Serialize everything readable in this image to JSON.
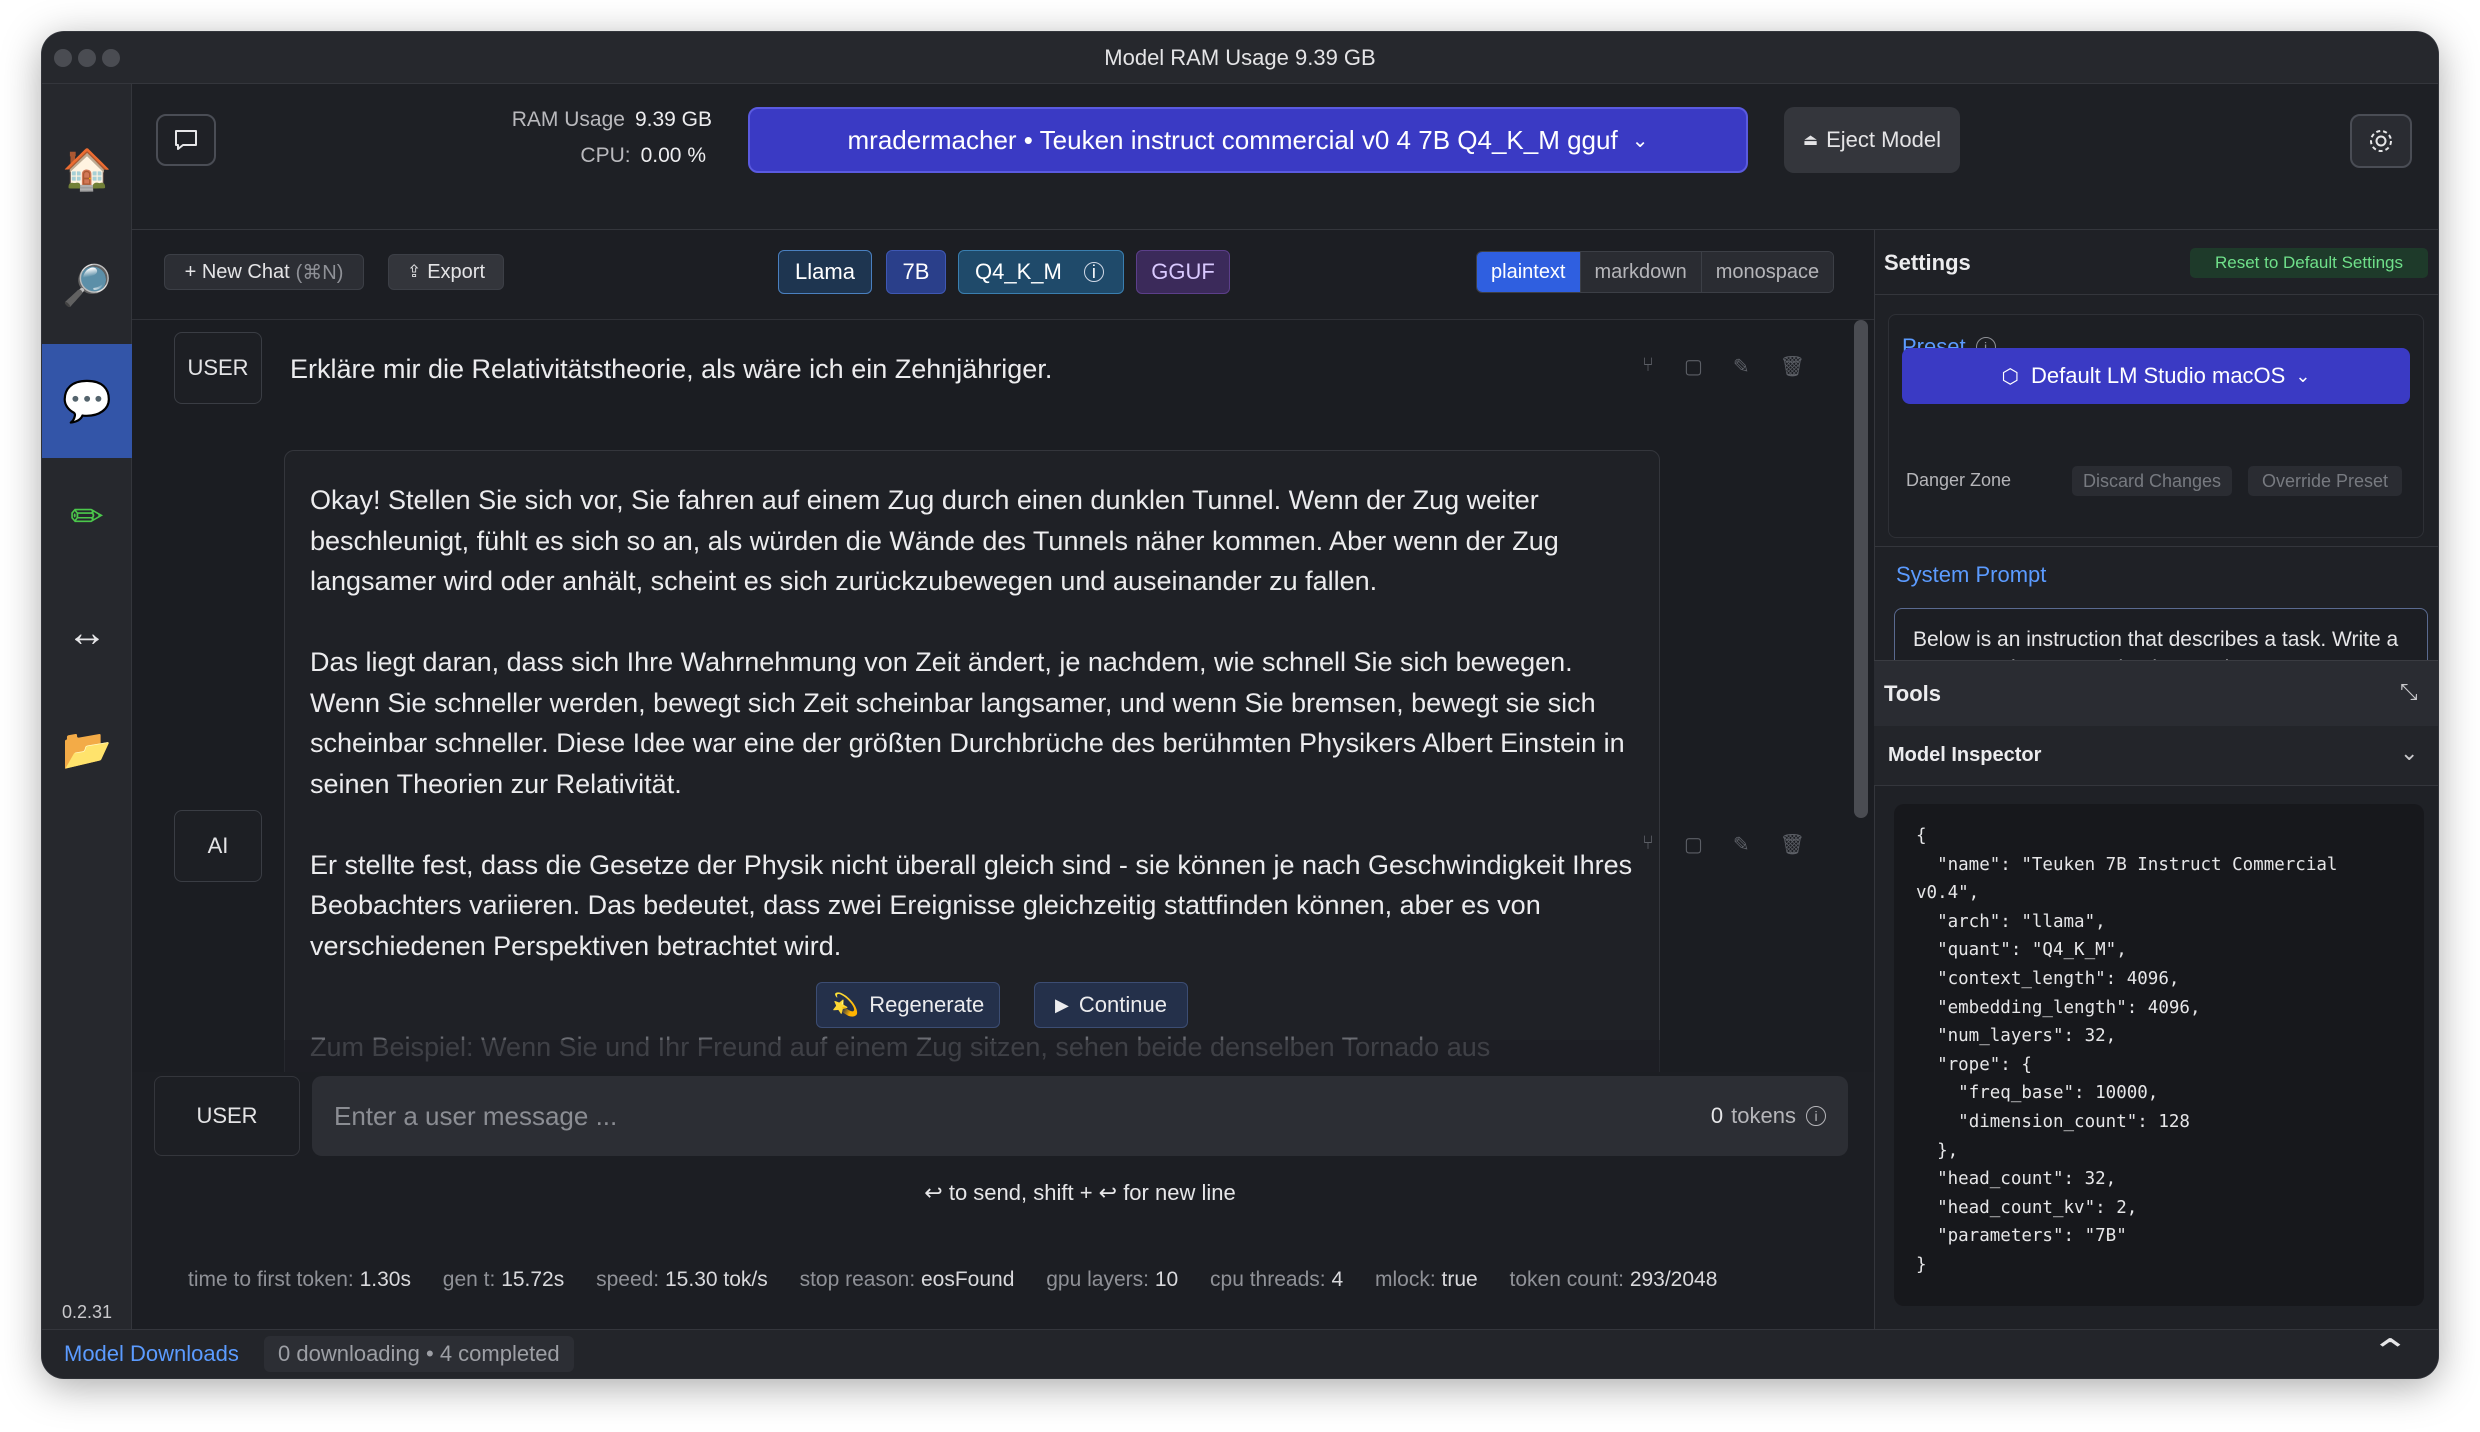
{
  "window": {
    "title": "Model RAM Usage  9.39 GB"
  },
  "sidebar": {
    "items": [
      {
        "name": "home",
        "glyph": "🏠"
      },
      {
        "name": "search",
        "glyph": "🔎"
      },
      {
        "name": "chat",
        "glyph": "💬"
      },
      {
        "name": "edit",
        "glyph": "✏"
      },
      {
        "name": "server",
        "glyph": "↔"
      },
      {
        "name": "folder",
        "glyph": "📂"
      }
    ],
    "version": "0.2.31"
  },
  "topbar": {
    "ram_label": "RAM Usage",
    "ram_value": "9.39 GB",
    "cpu_label": "CPU:",
    "cpu_value": "0.00 %",
    "model_selected": "mradermacher • Teuken instruct commercial v0 4 7B Q4_K_M gguf",
    "eject_label": "Eject Model"
  },
  "chat_toolbar": {
    "new_chat": "+ New Chat",
    "new_chat_shortcut": "(⌘N)",
    "export": "Export",
    "tags": [
      "Llama",
      "7B",
      "Q4_K_M",
      "GGUF"
    ],
    "formats": [
      "plaintext",
      "markdown",
      "monospace"
    ],
    "active_format": "plaintext"
  },
  "messages": [
    {
      "role": "USER",
      "text": "Erkläre mir die Relativitätstheorie, als wäre ich ein Zehnjähriger."
    },
    {
      "role": "AI",
      "paragraphs": [
        "Okay! Stellen Sie sich vor, Sie fahren auf einem Zug durch einen dunklen Tunnel. Wenn der Zug weiter beschleunigt, fühlt es sich so an, als würden die Wände des Tunnels näher kommen. Aber wenn der Zug langsamer wird oder anhält, scheint es sich zurückzubewegen und auseinander zu fallen.",
        "Das liegt daran, dass sich Ihre Wahrnehmung von Zeit ändert, je nachdem, wie schnell Sie sich bewegen. Wenn Sie schneller werden, bewegt sich Zeit scheinbar langsamer, und wenn Sie bremsen, bewegt sie sich scheinbar schneller. Diese Idee war eine der größten Durchbrüche des berühmten Physikers Albert Einstein in seinen Theorien zur Relativität.",
        "Er stellte fest, dass die Gesetze der Physik nicht überall gleich sind - sie können je nach Geschwindigkeit Ihres Beobachters variieren. Das bedeutet, dass zwei Ereignisse gleichzeitig stattfinden können, aber es von verschiedenen Perspektiven betrachtet wird."
      ],
      "faded": "Zum Beispiel: Wenn Sie und Ihr Freund auf einem Zug sitzen, sehen beide denselben Tornado aus"
    }
  ],
  "actions": {
    "regenerate": "Regenerate",
    "continue": "Continue"
  },
  "input": {
    "role": "USER",
    "placeholder": "Enter a user message ...",
    "tokens_count": "0",
    "tokens_label": "tokens",
    "hint": "↩ to send, shift + ↩ for new line"
  },
  "stats": [
    {
      "label": "time to first token:",
      "value": "1.30s"
    },
    {
      "label": "gen t:",
      "value": "15.72s"
    },
    {
      "label": "speed:",
      "value": "15.30 tok/s"
    },
    {
      "label": "stop reason:",
      "value": "eosFound"
    },
    {
      "label": "gpu layers:",
      "value": "10"
    },
    {
      "label": "cpu threads:",
      "value": "4"
    },
    {
      "label": "mlock:",
      "value": "true"
    },
    {
      "label": "token count:",
      "value": "293/2048"
    }
  ],
  "settings": {
    "title": "Settings",
    "reset": "Reset to Default Settings",
    "preset_label": "Preset",
    "preset_value": "Default LM Studio macOS",
    "danger_zone": "Danger Zone",
    "discard": "Discard Changes",
    "override": "Override Preset",
    "system_prompt_label": "System Prompt",
    "system_prompt": "Below is an instruction that describes a task. Write a response that appropriately completes",
    "tools_label": "Tools",
    "inspector_label": "Model Inspector",
    "inspector_json": "{\n  \"name\": \"Teuken 7B Instruct Commercial v0.4\",\n  \"arch\": \"llama\",\n  \"quant\": \"Q4_K_M\",\n  \"context_length\": 4096,\n  \"embedding_length\": 4096,\n  \"num_layers\": 32,\n  \"rope\": {\n    \"freq_base\": 10000,\n    \"dimension_count\": 128\n  },\n  \"head_count\": 32,\n  \"head_count_kv\": 2,\n  \"parameters\": \"7B\"\n}"
  },
  "bottom": {
    "downloads_label": "Model Downloads",
    "downloads_status": "0 downloading • 4 completed"
  },
  "colors": {
    "accent": "#3a3ac4",
    "active_sidebar": "#3355a8",
    "link": "#5b9bff"
  }
}
